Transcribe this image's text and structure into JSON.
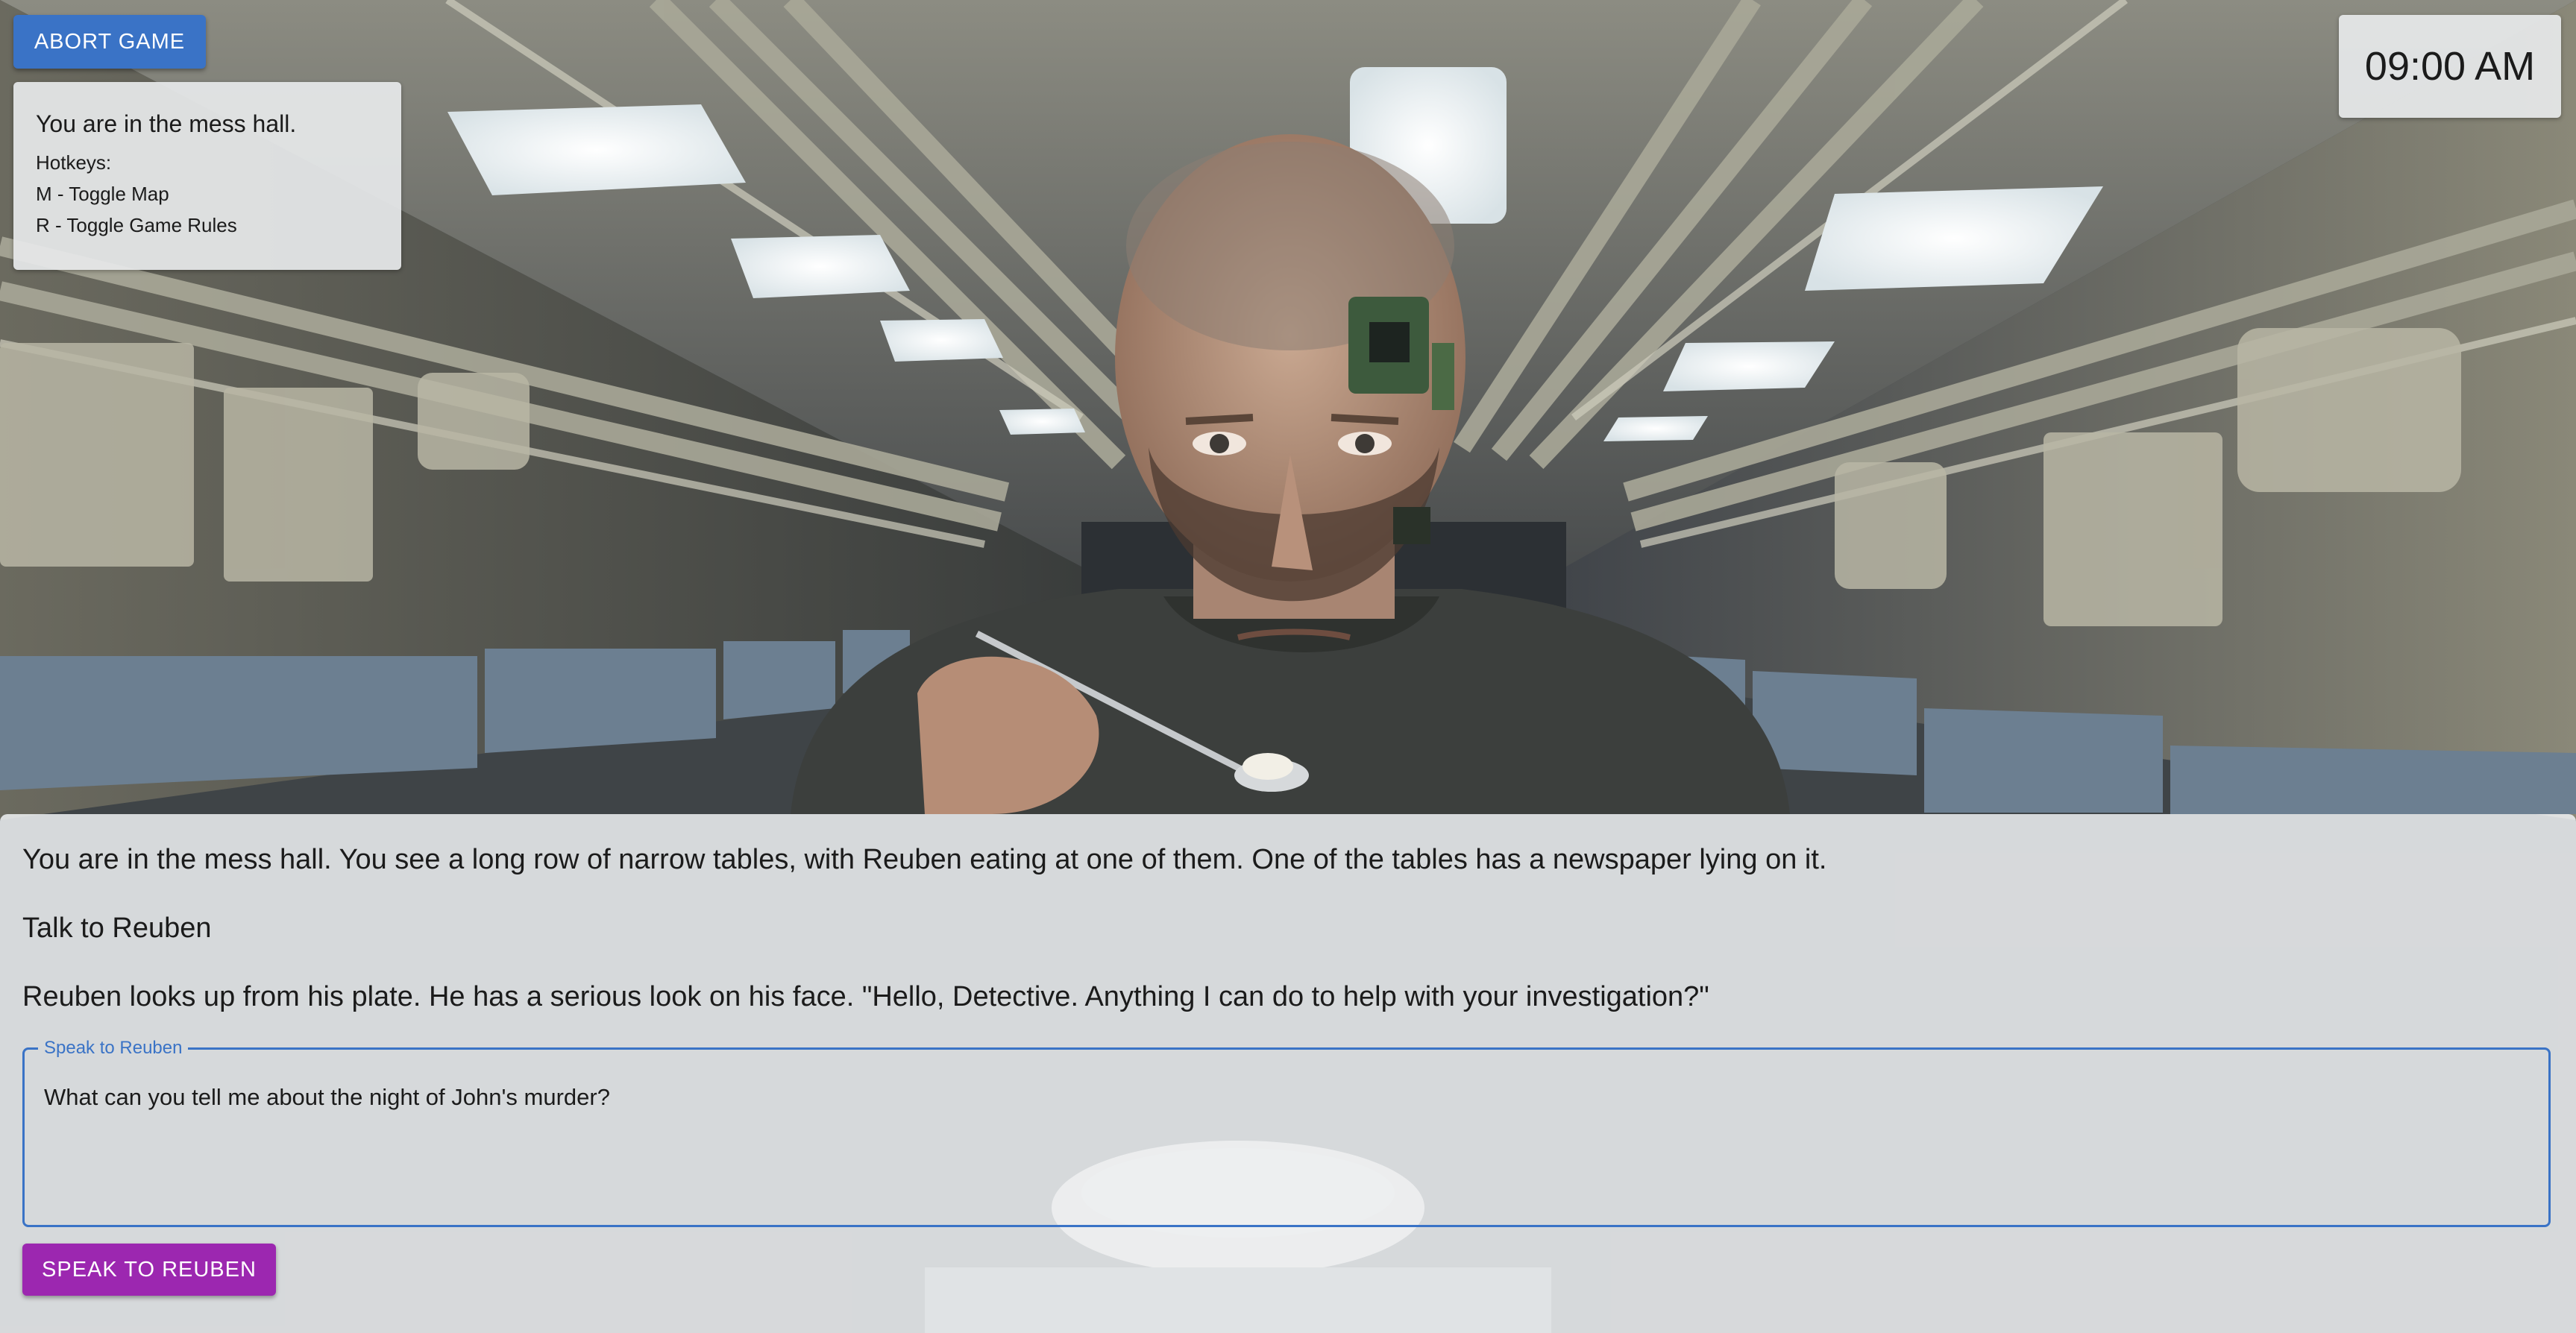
{
  "game": {
    "abort_label": "ABORT GAME",
    "clock": "09:00 AM"
  },
  "info_panel": {
    "location": "You are in the mess hall.",
    "hotkeys_title": "Hotkeys:",
    "hotkeys": [
      "M - Toggle Map",
      "R - Toggle Game Rules"
    ]
  },
  "dialog": {
    "narration": "You are in the mess hall. You see a long row of narrow tables, with Reuben eating at one of them. One of the tables has a newspaper lying on it.",
    "choice": "Talk to Reuben",
    "response": "Reuben looks up from his plate. He has a serious look on his face. \"Hello, Detective. Anything I can do to help with your investigation?\"",
    "input_label": "Speak to Reuben",
    "input_value": "What can you tell me about the night of John's murder?",
    "submit_label": "SPEAK TO REUBEN"
  },
  "colors": {
    "abort_button": "#3a73c6",
    "speak_button": "#9c27b0",
    "input_border": "#3a73c6"
  },
  "scene": {
    "icons": [
      "ceiling-lights",
      "pipes",
      "benches",
      "character-reuben",
      "circuit-implant",
      "spoon",
      "rice-bowl"
    ]
  }
}
